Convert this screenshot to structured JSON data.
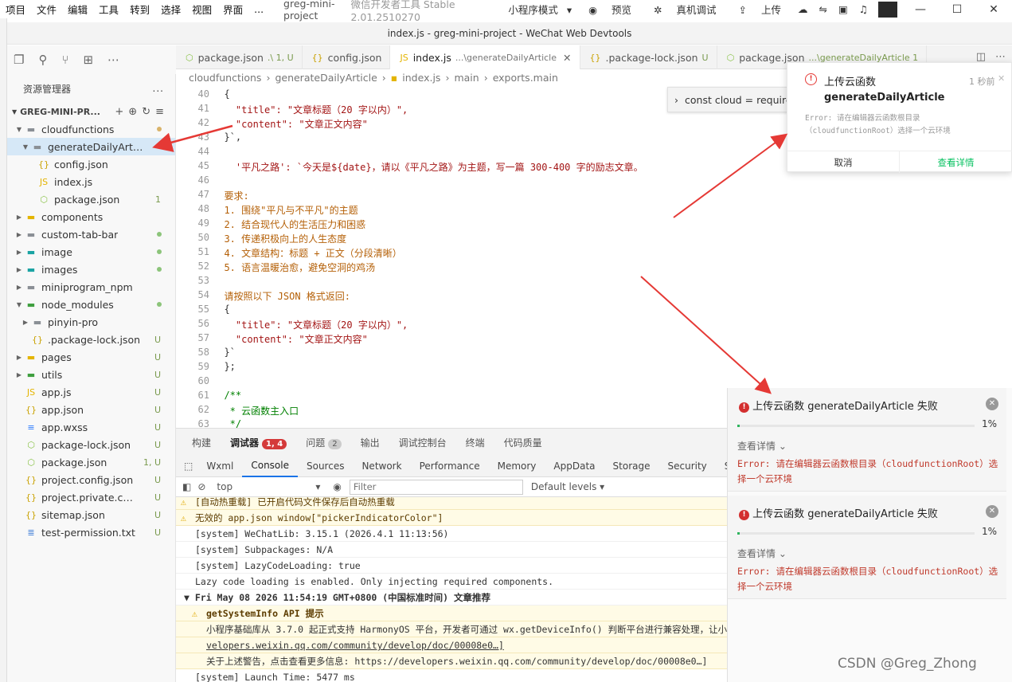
{
  "menu": {
    "items": [
      "项目",
      "文件",
      "编辑",
      "工具",
      "转到",
      "选择",
      "视图",
      "界面",
      "..."
    ],
    "project": "greg-mini-project",
    "tool_name": "微信开发者工具 Stable 2.01.2510270",
    "mode": "小程序模式",
    "preview": "预览",
    "device_debug": "真机调试",
    "upload": "上传"
  },
  "window": {
    "title": "index.js - greg-mini-project - WeChat Web Devtools"
  },
  "explorer": {
    "title": "资源管理器",
    "more": "...",
    "root": "GREG-MINI-PR...",
    "tree": [
      {
        "name": "cloudfunctions",
        "type": "folder",
        "indent": 1,
        "open": true,
        "status": "dot-y"
      },
      {
        "name": "generateDailyArti...",
        "type": "folder",
        "indent": 2,
        "open": true,
        "selected": true
      },
      {
        "name": "config.json",
        "type": "json",
        "indent": 3
      },
      {
        "name": "index.js",
        "type": "js",
        "indent": 3
      },
      {
        "name": "package.json",
        "type": "pkg",
        "indent": 3,
        "status": "1"
      },
      {
        "name": "components",
        "type": "folder-y",
        "indent": 1,
        "open": false
      },
      {
        "name": "custom-tab-bar",
        "type": "folder",
        "indent": 1,
        "open": false,
        "status": "dot"
      },
      {
        "name": "image",
        "type": "folder-t",
        "indent": 1,
        "open": false,
        "status": "dot"
      },
      {
        "name": "images",
        "type": "folder-t",
        "indent": 1,
        "open": false,
        "status": "dot"
      },
      {
        "name": "miniprogram_npm",
        "type": "folder",
        "indent": 1,
        "open": false
      },
      {
        "name": "node_modules",
        "type": "folder-g",
        "indent": 1,
        "open": true,
        "status": "dot"
      },
      {
        "name": "pinyin-pro",
        "type": "folder",
        "indent": 2,
        "open": false
      },
      {
        "name": ".package-lock.json",
        "type": "json",
        "indent": 2,
        "status": "U"
      },
      {
        "name": "pages",
        "type": "folder-y",
        "indent": 1,
        "open": false,
        "status": "U"
      },
      {
        "name": "utils",
        "type": "folder-g",
        "indent": 1,
        "open": false,
        "status": "U"
      },
      {
        "name": "app.js",
        "type": "js",
        "indent": 1,
        "status": "U"
      },
      {
        "name": "app.json",
        "type": "json",
        "indent": 1,
        "status": "U"
      },
      {
        "name": "app.wxss",
        "type": "wxss",
        "indent": 1,
        "status": "U"
      },
      {
        "name": "package-lock.json",
        "type": "pkg",
        "indent": 1,
        "status": "U"
      },
      {
        "name": "package.json",
        "type": "pkg",
        "indent": 1,
        "status": "1, U"
      },
      {
        "name": "project.config.json",
        "type": "json",
        "indent": 1,
        "status": "U"
      },
      {
        "name": "project.private.confi...",
        "type": "json",
        "indent": 1,
        "status": "U"
      },
      {
        "name": "sitemap.json",
        "type": "json",
        "indent": 1,
        "status": "U"
      },
      {
        "name": "test-permission.txt",
        "type": "txt",
        "indent": 1,
        "status": "U"
      }
    ]
  },
  "tabs": [
    {
      "label": "package.json",
      "extra": ".\\ 1, U",
      "icon": "pkg"
    },
    {
      "label": "config.json",
      "extra": "",
      "icon": "json"
    },
    {
      "label": "index.js",
      "extra": "...\\generateDailyArticle",
      "icon": "js",
      "active": true
    },
    {
      "label": ".package-lock.json",
      "extra": "U",
      "icon": "json"
    },
    {
      "label": "package.json",
      "extra": "...\\generateDailyArticle 1",
      "icon": "pkg"
    }
  ],
  "breadcrumb": [
    "cloudfunctions",
    "generateDailyArticle",
    "index.js",
    "main",
    "exports.main"
  ],
  "find_widget": "const cloud = require",
  "code": [
    {
      "n": "40",
      "t": "  {"
    },
    {
      "n": "41",
      "t": "    \"title\": \"文章标题（20 字以内）\","
    },
    {
      "n": "42",
      "t": "    \"content\": \"文章正文内容\""
    },
    {
      "n": "43",
      "t": "  }`,"
    },
    {
      "n": "44",
      "t": ""
    },
    {
      "n": "45",
      "t": "    '平凡之路': `今天是${date}，请以《平凡之路》为主题，写一篇 300-400 字的励志文章。"
    },
    {
      "n": "46",
      "t": ""
    },
    {
      "n": "47",
      "t": "  要求:"
    },
    {
      "n": "48",
      "t": "  1. 围绕\"平凡与不平凡\"的主题"
    },
    {
      "n": "49",
      "t": "  2. 结合现代人的生活压力和困惑"
    },
    {
      "n": "50",
      "t": "  3. 传递积极向上的人生态度"
    },
    {
      "n": "51",
      "t": "  4. 文章结构：标题 + 正文（分段清晰）"
    },
    {
      "n": "52",
      "t": "  5. 语言温暖治愈，避免空洞的鸡汤"
    },
    {
      "n": "53",
      "t": ""
    },
    {
      "n": "54",
      "t": "  请按照以下 JSON 格式返回:"
    },
    {
      "n": "55",
      "t": "  {"
    },
    {
      "n": "56",
      "t": "    \"title\": \"文章标题（20 字以内）\","
    },
    {
      "n": "57",
      "t": "    \"content\": \"文章正文内容\""
    },
    {
      "n": "58",
      "t": "  }`"
    },
    {
      "n": "59",
      "t": "  };"
    },
    {
      "n": "60",
      "t": ""
    },
    {
      "n": "61",
      "t": "  /**"
    },
    {
      "n": "62",
      "t": "   * 云函数主入口"
    },
    {
      "n": "63",
      "t": "   */"
    }
  ],
  "panel_tabs": {
    "build": "构建",
    "debugger": "调试器",
    "debugger_badge": "1, 4",
    "issues": "问题",
    "issues_badge": "2",
    "output": "输出",
    "debug_console": "调试控制台",
    "terminal": "终端",
    "code_quality": "代码质量"
  },
  "devtools_tabs": [
    "Wxml",
    "Console",
    "Sources",
    "Network",
    "Performance",
    "Memory",
    "AppData",
    "Storage",
    "Security",
    "Sen"
  ],
  "console_toolbar": {
    "context": "top",
    "filter_placeholder": "Filter",
    "levels": "Default levels"
  },
  "console_lines": [
    {
      "t": "[自动热重载] 已开启代码文件保存后自动热重载",
      "warn": true
    },
    {
      "t": "无效的 app.json window[\"pickerIndicatorColor\"]",
      "warn": true
    },
    {
      "t": "[system] WeChatLib: 3.15.1 (2026.4.1 11:13:56)"
    },
    {
      "t": "[system] Subpackages: N/A"
    },
    {
      "t": "[system] LazyCodeLoading: true"
    },
    {
      "t": "Lazy code loading is enabled. Only injecting required components."
    },
    {
      "t": "▼ Fri May 08 2026 11:54:19 GMT+0800 (中国标准时间) 文章推荐"
    },
    {
      "t": "getSystemInfo API 提示",
      "warn": true
    },
    {
      "t": "小程序基础库从 3.7.0 起正式支持 HarmonyOS 平台，开发者可通过 wx.getDeviceInfo() 判断平台进行兼容处理，让小"
    },
    {
      "t": "velopers.weixin.qq.com/community/develop/doc/00008e0…]"
    },
    {
      "t": "关于上述警告，点击查看更多信息: https://developers.weixin.qq.com/community/develop/doc/00008e0…]"
    },
    {
      "t": "[system] Launch Time: 5477 ms"
    }
  ],
  "notification_top": {
    "title": "上传云函数",
    "time": "1 秒前",
    "name": "generateDailyArticle",
    "error": "Error: 请在编辑器云函数根目录（cloudfunctionRoot）选择一个云环境",
    "cancel": "取消",
    "details": "查看详情"
  },
  "upload_cards": [
    {
      "title": "上传云函数 generateDailyArticle 失败",
      "progress_pct": "1%",
      "progress": 0.01,
      "details": "查看详情",
      "error": "Error: 请在编辑器云函数根目录（cloudfunctionRoot）选择一个云环境"
    },
    {
      "title": "上传云函数 generateDailyArticle 失败",
      "progress_pct": "1%",
      "progress": 0.01,
      "details": "查看详情",
      "error": "Error: 请在编辑器云函数根目录（cloudfunctionRoot）选择一个云环境"
    }
  ],
  "watermark": "CSDN @Greg_Zhong",
  "colors": {
    "accent": "#1a73e8",
    "error": "#c0392b",
    "success": "#2fb55e",
    "link_green": "#07c160"
  }
}
